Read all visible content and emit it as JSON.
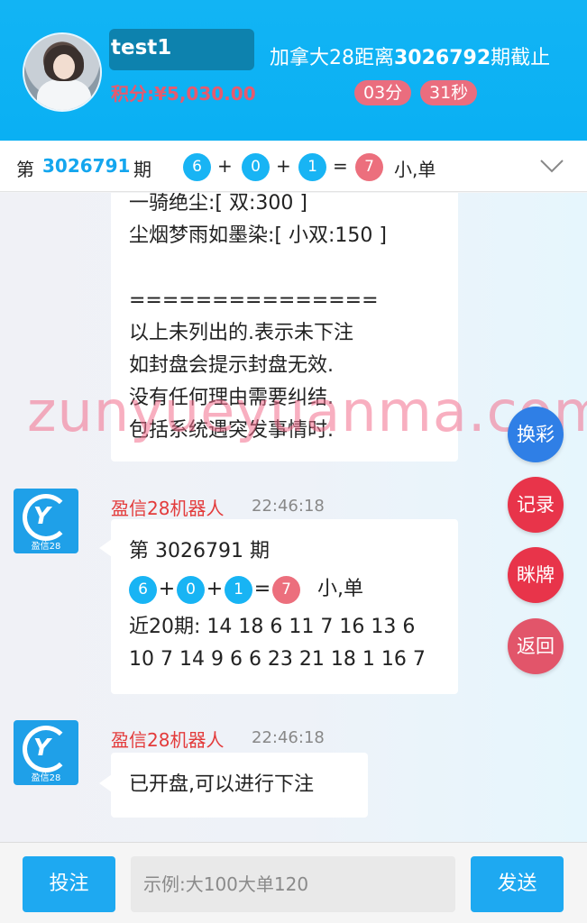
{
  "header": {
    "username": "test1",
    "score": "积分:¥5,030.00",
    "period_prefix": "加拿大28距离",
    "period_number": "3026792",
    "period_suffix": "期截止",
    "timer_minutes": "03分",
    "timer_seconds": "31秒"
  },
  "result_bar": {
    "prefix": "第",
    "period": "3026791",
    "suffix": "期",
    "balls": [
      "6",
      "0",
      "1"
    ],
    "sum": "7",
    "result": "小,单"
  },
  "messages": [
    {
      "lines": [
        "一骑绝尘:[ 双:300 ]",
        "尘烟梦雨如墨染:[ 小双:150 ]",
        "",
        "===============",
        "以上未列出的.表示未下注",
        "如封盘会提示封盘无效.",
        "没有任何理由需要纠结.",
        "包括系统遇突发事情时."
      ]
    },
    {
      "sender": "盈信28机器人",
      "time": "22:46:18",
      "avatar_label": "盈信28",
      "period_line": "第 3026791 期",
      "balls": [
        "6",
        "0",
        "1"
      ],
      "sum": "7",
      "result": "小,单",
      "history_line1": "近20期: 14 18 6 11 7 16 13 6",
      "history_line2": "10 7 14 9 6 6 23 21 18 1 16 7"
    },
    {
      "sender": "盈信28机器人",
      "time": "22:46:18",
      "avatar_label": "盈信28",
      "text": "已开盘,可以进行下注"
    }
  ],
  "side_buttons": [
    "换彩",
    "记录",
    "眯牌",
    "返回"
  ],
  "watermark": "zunyueyuanma.com",
  "bottom": {
    "bet_label": "投注",
    "input_placeholder": "示例:大100大单120",
    "send_label": "发送"
  },
  "colors": {
    "header": "#12b4f4",
    "accent_blue": "#1ea9f1",
    "ball_blue": "#18b4f4",
    "ball_red": "#ec6f7d",
    "sender_red": "#e33b3b"
  }
}
